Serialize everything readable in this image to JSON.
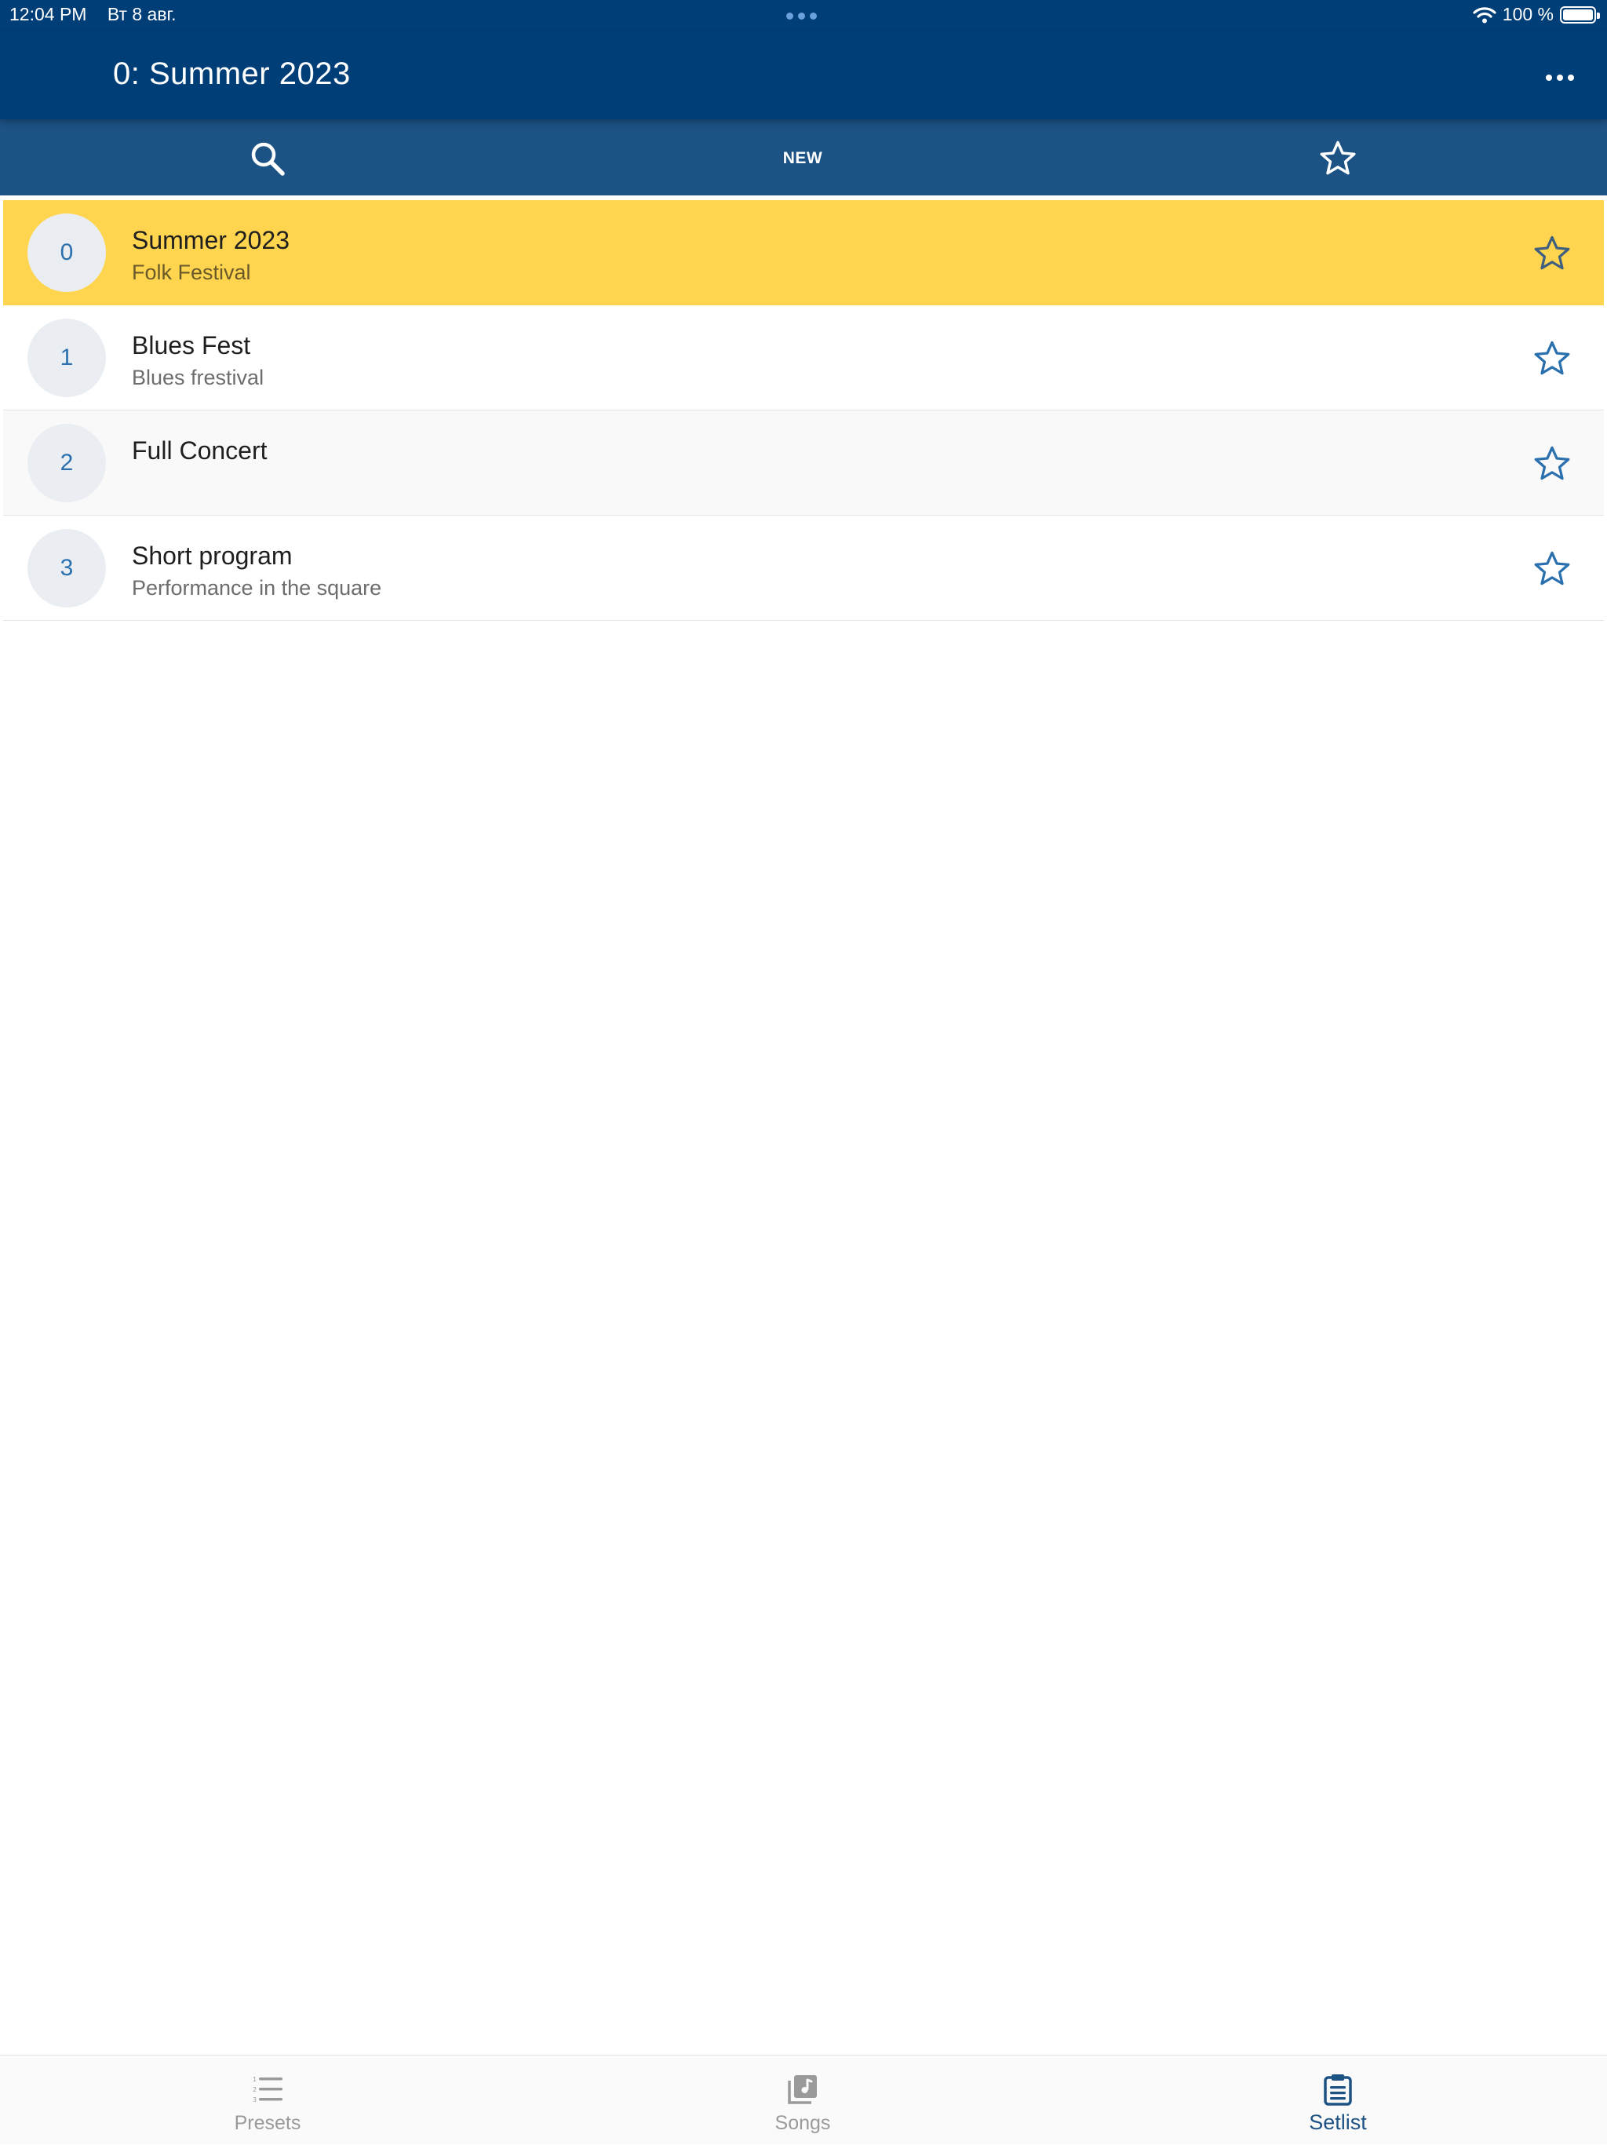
{
  "status_bar": {
    "time": "12:04 PM",
    "date": "Вт 8 авг.",
    "battery": "100 %",
    "battery_level": 1.0
  },
  "header": {
    "title": "0: Summer 2023",
    "more_icon": "ellipsis-icon"
  },
  "toolbar": {
    "search_icon": "search-icon",
    "new_label": "NEW",
    "favorites_icon": "star-icon"
  },
  "setlists": [
    {
      "number": "0",
      "title": "Summer 2023",
      "subtitle": "Folk Festival",
      "selected": true
    },
    {
      "number": "1",
      "title": "Blues Fest",
      "subtitle": "Blues frestival",
      "selected": false
    },
    {
      "number": "2",
      "title": "Full Concert",
      "subtitle": "",
      "selected": false
    },
    {
      "number": "3",
      "title": "Short program",
      "subtitle": "Performance in the square",
      "selected": false
    }
  ],
  "tabs": [
    {
      "label": "Presets",
      "icon": "numbered-list-icon",
      "active": false
    },
    {
      "label": "Songs",
      "icon": "music-album-icon",
      "active": false
    },
    {
      "label": "Setlist",
      "icon": "clipboard-icon",
      "active": true
    }
  ],
  "colors": {
    "header_bg": "#003e78",
    "toolbar_bg": "#1d5285",
    "selected_row": "#ffd54f",
    "accent": "#1d5285"
  }
}
